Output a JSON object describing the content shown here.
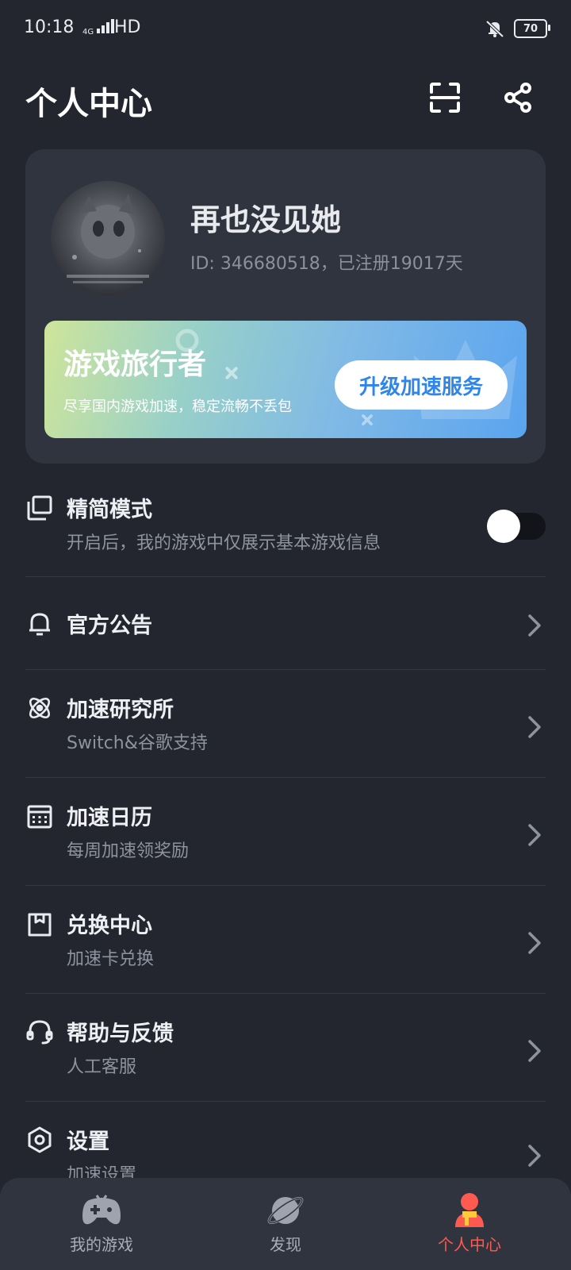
{
  "status_bar": {
    "time": "10:18",
    "network": "4G",
    "hd": "HD",
    "battery": "70"
  },
  "header": {
    "title": "个人中心",
    "icons": [
      "scan-icon",
      "share-icon"
    ]
  },
  "profile": {
    "username": "再也没见她",
    "id_line": "ID: 346680518，已注册19017天"
  },
  "vip_banner": {
    "title": "游戏旅行者",
    "desc": "尽享国内游戏加速，稳定流畅不丢包",
    "button": "升级加速服务"
  },
  "simple_mode": {
    "title": "精简模式",
    "subtitle": "开启后，我的游戏中仅展示基本游戏信息",
    "enabled": false
  },
  "menu": [
    {
      "title": "官方公告",
      "subtitle": "",
      "icon": "bell-icon"
    },
    {
      "title": "加速研究所",
      "subtitle": "Switch&谷歌支持",
      "icon": "atom-icon"
    },
    {
      "title": "加速日历",
      "subtitle": "每周加速领奖励",
      "icon": "calendar-icon"
    },
    {
      "title": "兑换中心",
      "subtitle": "加速卡兑换",
      "icon": "gift-box-icon"
    },
    {
      "title": "帮助与反馈",
      "subtitle": "人工客服",
      "icon": "headset-icon"
    },
    {
      "title": "设置",
      "subtitle": "加速设置",
      "icon": "settings-hex-icon"
    }
  ],
  "bottom_nav": [
    {
      "label": "我的游戏",
      "icon": "gamepad-icon",
      "active": false
    },
    {
      "label": "发现",
      "icon": "planet-icon",
      "active": false
    },
    {
      "label": "个人中心",
      "icon": "person-icon",
      "active": true
    }
  ],
  "colors": {
    "background": "#23262f",
    "card": "#30343f",
    "accent_active": "#ff5a4f",
    "vip_button_text": "#2f86e8"
  }
}
